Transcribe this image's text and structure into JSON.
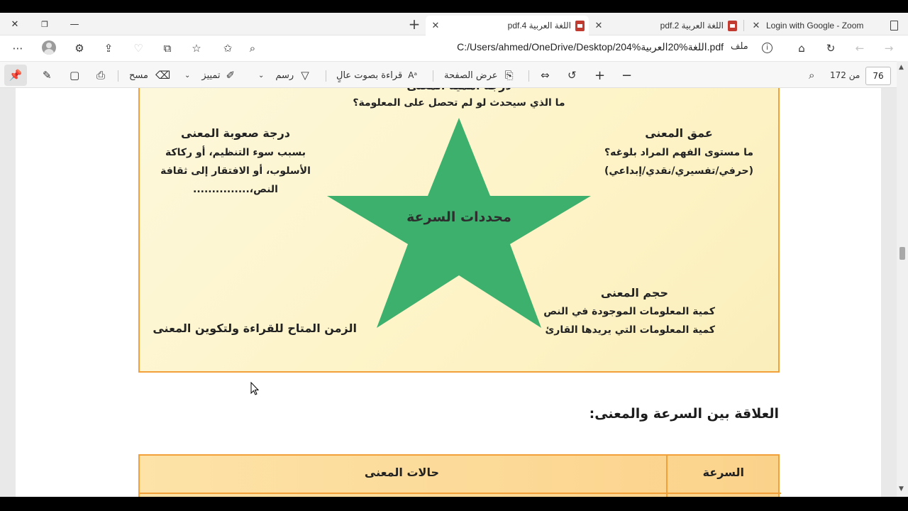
{
  "browser": {
    "window_controls": {
      "close": "✕",
      "restore": "❐",
      "minimize": "—"
    },
    "tabs": [
      {
        "title": "pdf.4 اللغة العربية",
        "active": true
      },
      {
        "title": "pdf.2 اللغة العربية",
        "active": false
      },
      {
        "title": "Login with Google - Zoom",
        "active": false
      }
    ],
    "new_tab": "+",
    "address": {
      "url": "C:/Users/ahmed/OneDrive/Desktop/اللغة%20العربية%204.pdf",
      "prefix": "ملف"
    }
  },
  "pdf_toolbar": {
    "erase_label": "مسح",
    "highlight_label": "تمييز",
    "draw_label": "رسم",
    "read_aloud_label": "قراءة بصوت عالٍ",
    "page_view_label": "عرض الصفحة",
    "page_total": "من 172",
    "current_page": "76"
  },
  "document": {
    "top_partial": "درجة أهمية المعنى",
    "top_question": "ما الذي سيحدث لو لم تحصل على المعلومة؟",
    "star_center": "محددات السرعة",
    "difficulty": {
      "title": "درجة صعوبة المعنى",
      "lines": [
        "بسبب سوء التنظيم، أو ركاكة",
        "الأسلوب، أو الافتقار إلى ثقافة",
        "النص،..............."
      ]
    },
    "depth": {
      "title": "عمق المعنى",
      "lines": [
        "ما مستوى الفهم المراد بلوغه؟",
        "(حرفي/تفسيري/نقدي/إبداعي)"
      ]
    },
    "volume": {
      "title": "حجم المعنى",
      "lines": [
        "كمية المعلومات الموجودة في النص",
        "كمية المعلومات التي يريدها القارئ"
      ]
    },
    "time": "الزمن المتاح للقراءة ولتكوين المعنى",
    "relation_heading": "العلاقة بين السرعة والمعنى:",
    "table_headers": {
      "speed": "السرعة",
      "meaning_states": "حالات المعنى"
    }
  },
  "colors": {
    "star": "#3db06e",
    "box_border": "#f2a13a"
  }
}
